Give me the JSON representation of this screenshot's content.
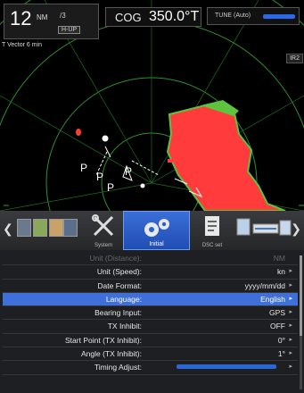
{
  "header": {
    "range_value": "12",
    "range_unit": "NM",
    "range_rings": "/3",
    "orientation": "H-UP",
    "cog_label": "COG",
    "cog_value": "350.0°T",
    "tune_label": "TUNE (Auto)",
    "vector_label": "T Vector 6 min",
    "interference_label": "IR2"
  },
  "menu": {
    "tabs": [
      {
        "label": ""
      },
      {
        "label": "System"
      },
      {
        "label": "Initial"
      },
      {
        "label": "DSC set"
      },
      {
        "label": ""
      }
    ],
    "active_tab": "Initial"
  },
  "settings": [
    {
      "label": "Unit (Distance):",
      "value": "NM",
      "state": "disabled"
    },
    {
      "label": "Unit (Speed):",
      "value": "kn"
    },
    {
      "label": "Date Format:",
      "value": "yyyy/mm/dd"
    },
    {
      "label": "Language:",
      "value": "English",
      "state": "selected"
    },
    {
      "label": "Bearing Input:",
      "value": "GPS"
    },
    {
      "label": "TX Inhibit:",
      "value": "OFF"
    },
    {
      "label": "Start Point (TX Inhibit):",
      "value": "0°"
    },
    {
      "label": "Angle (TX Inhibit):",
      "value": "1°"
    },
    {
      "label": "Timing Adjust:",
      "value": ""
    }
  ],
  "target_labels": [
    "P",
    "P",
    "P",
    "P"
  ],
  "colors": {
    "echo": "#ff3b3b",
    "echo_edge": "#5ec33f",
    "ring": "#2f8f2f",
    "selected_row": "#3f6fd9",
    "tab_active": "#2a5fd0"
  }
}
